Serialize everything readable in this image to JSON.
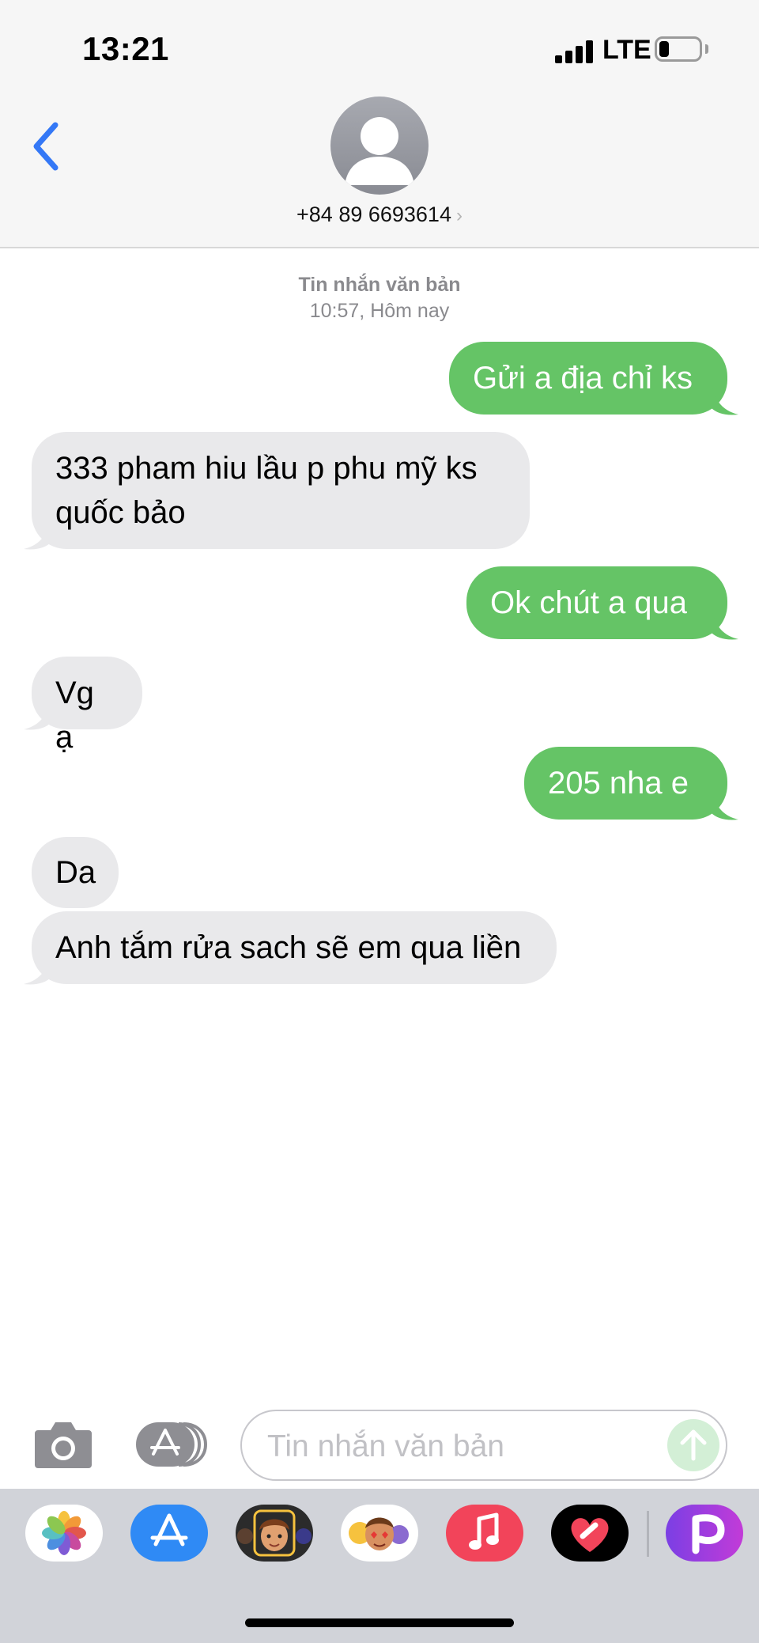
{
  "status_bar": {
    "time": "13:21",
    "network": "LTE",
    "battery_level": 0.25
  },
  "header": {
    "contact": "+84 89 6693614",
    "back_icon": "chevron-left-icon",
    "avatar_icon": "person-silhouette-icon",
    "accent_color": "#3478f6"
  },
  "conversation": {
    "timestamp_label": "Tin nhắn văn bản",
    "timestamp_time": "10:57, Hôm nay",
    "messages": [
      {
        "from": "me",
        "text": "Gửi a địa chỉ ks"
      },
      {
        "from": "them",
        "lines": [
          "333 pham hiu lầu p phu mỹ ks",
          "quốc bảo"
        ]
      },
      {
        "from": "me",
        "text": "Ok chút a qua"
      },
      {
        "from": "them",
        "text": "Vg ạ"
      },
      {
        "from": "me",
        "text": "205 nha e"
      },
      {
        "from": "them",
        "text": "Da"
      },
      {
        "from": "them",
        "text": "Anh tắm rửa sach sẽ em qua liền"
      }
    ],
    "sent_color": "#65c466",
    "received_color": "#e9e9eb"
  },
  "input_bar": {
    "placeholder": "Tin nhắn văn bản",
    "camera_icon": "camera-icon",
    "apps_icon": "app-store-icon",
    "send_icon": "arrow-up-icon"
  },
  "app_drawer": {
    "apps": [
      "photos-icon",
      "app-store-icon",
      "memoji-icon",
      "animoji-stickers-icon",
      "music-icon",
      "digital-touch-icon",
      "picsart-icon"
    ]
  }
}
